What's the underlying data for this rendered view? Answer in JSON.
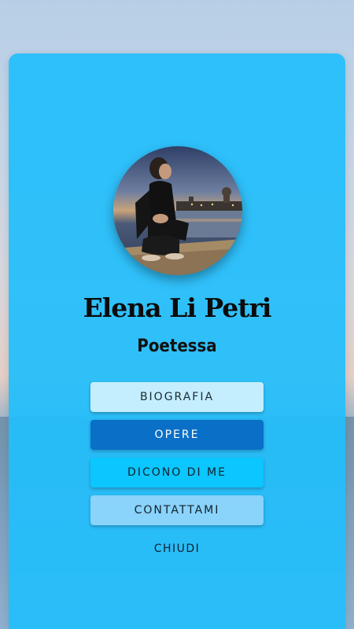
{
  "profile": {
    "name": "Elena Li Petri",
    "subtitle": "Poetessa",
    "avatar_alt": "profile-photo"
  },
  "menu": {
    "biografia": "BIOGRAFIA",
    "opere": "OPERE",
    "dicono": "DICONO DI ME",
    "contatti": "CONTATTAMI",
    "chiudi": "CHIUDI"
  },
  "colors": {
    "card": "#22befc",
    "biografia_bg": "#c4eefd",
    "opere_bg": "#0a6fc7",
    "dicono_bg": "#0bc6ff",
    "contatti_bg": "#8ad3fb"
  }
}
